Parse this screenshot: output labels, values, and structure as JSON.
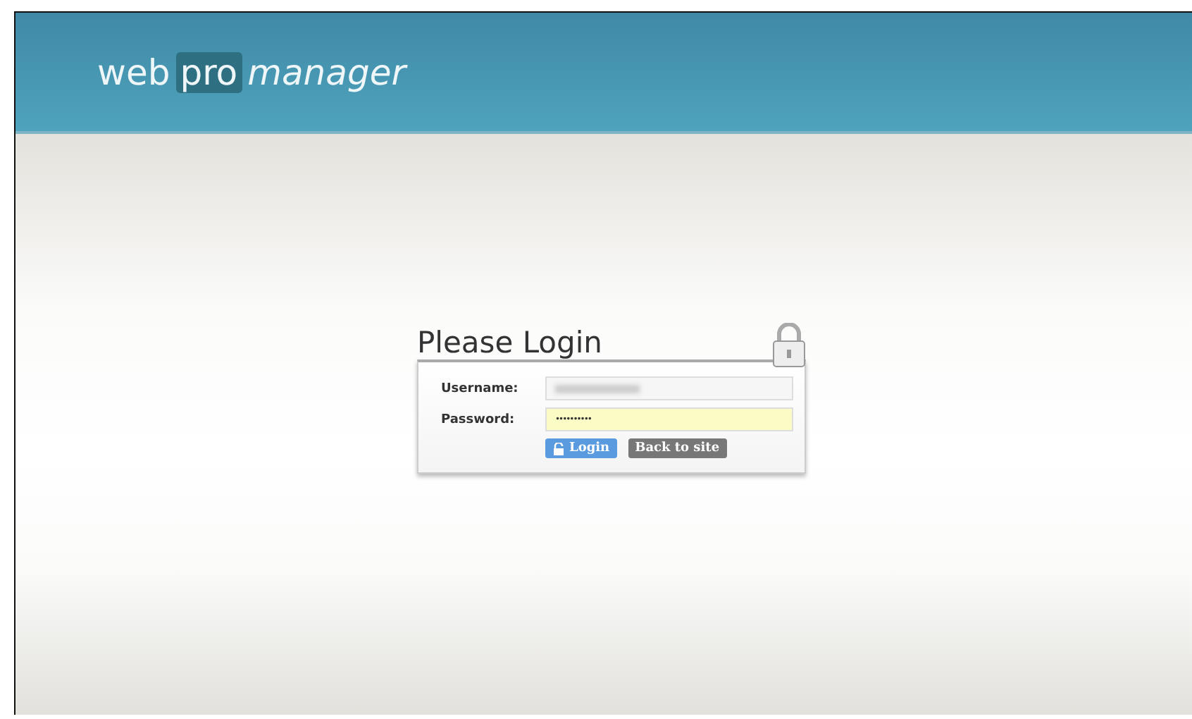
{
  "logo": {
    "part_1": "web",
    "part_2": "pro",
    "part_3": "manager"
  },
  "login": {
    "title": "Please Login",
    "fields": [
      {
        "label": "Username:",
        "kind": "redacted",
        "highlighted": false
      },
      {
        "label": "Password:",
        "kind": "password",
        "value": "••••••••••",
        "highlighted": true
      }
    ],
    "buttons": [
      {
        "label": "Login",
        "kind": "primary"
      },
      {
        "label": "Back to site",
        "kind": "secondary"
      }
    ]
  }
}
